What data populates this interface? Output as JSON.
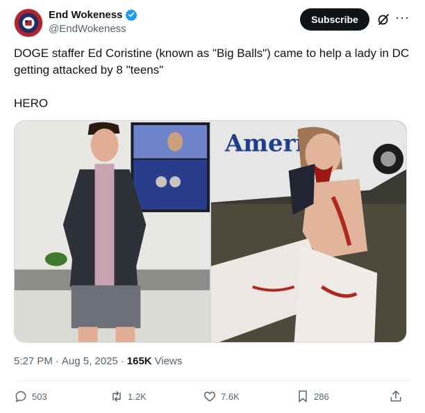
{
  "author": {
    "display_name": "End Wokeness",
    "handle": "@EndWokeness",
    "avatar_icon": "avatar-badge-icon",
    "verified_icon": "verified-badge-icon",
    "verified_color": "#1d9bf0"
  },
  "header": {
    "subscribe_label": "Subscribe",
    "grok_icon": "grok-icon",
    "more_icon": "more-icon"
  },
  "tweet": {
    "text_line1": "DOGE staffer Ed Coristine (known as \"Big Balls\") came to help a lady in DC getting attacked by 8 \"teens\"",
    "text_line2": "HERO"
  },
  "media": {
    "photo_left_sign": "",
    "photo_right_sign": "America"
  },
  "meta": {
    "time": "5:27 PM",
    "separator": "·",
    "date": "Aug 5, 2025",
    "views_count": "165K",
    "views_label": "Views"
  },
  "actions": {
    "replies": "503",
    "reposts": "1.2K",
    "likes": "7.6K",
    "bookmarks": "286"
  },
  "colors": {
    "text_primary": "#0f1419",
    "text_secondary": "#536471",
    "subscribe_bg": "#0f1419"
  }
}
